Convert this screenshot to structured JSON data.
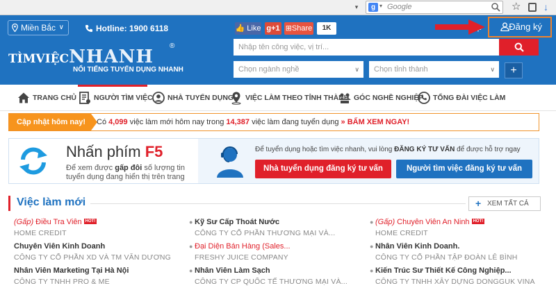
{
  "browser": {
    "search_placeholder": "Google",
    "engine_letter": "g"
  },
  "header": {
    "region": "Miền Bắc",
    "hotline": "Hotline: 1900 6118",
    "social": {
      "like": "Like",
      "gplus": "g+1",
      "share": "Share",
      "count": "1K"
    },
    "login_partial": "ập",
    "register": "Đăng ký",
    "logo_top": "TÌMVIỆC",
    "logo_big": "NHANH",
    "logo_reg": "®",
    "tagline": "NỔI TIẾNG TUYỂN DỤNG NHANH",
    "search_placeholder": "Nhập tên công việc, vị trí...",
    "industry_placeholder": "Chọn ngành nghề",
    "province_placeholder": "Chọn tỉnh thành",
    "plus": "+"
  },
  "nav": {
    "items": [
      {
        "label": "TRANG CHỦ"
      },
      {
        "label": "NGƯỜI TÌM VIỆC"
      },
      {
        "label": "NHÀ TUYỂN DỤNG"
      },
      {
        "label": "VIỆC LÀM THEO TỈNH THÀNH"
      },
      {
        "label": "GÓC NGHỀ NGHIỆP"
      },
      {
        "label": "TỔNG ĐÀI VIỆC LÀM"
      }
    ]
  },
  "ticker": {
    "label": "Cập nhật hôm nay!",
    "p1": "Có ",
    "new_count": "4,099",
    "p2": " việc làm mới hôm nay trong ",
    "total_count": "14,387",
    "p3": " việc làm đang tuyển dụng ",
    "cta": "»  BẤM XEM NGAY!"
  },
  "banner": {
    "title_pre": "Nhấn phím ",
    "title_key": "F5",
    "desc_pre": "Để xem được ",
    "desc_bold": "gấp đôi",
    "desc_post": " số lượng tin tuyển dụng đang hiển thị trên trang",
    "consult_pre": "Để tuyển dụng hoặc tìm việc nhanh, vui lòng ",
    "consult_bold": "ĐĂNG KÝ TƯ VẤN",
    "consult_post": " để được hỗ trợ ngay",
    "employer_btn": "Nhà tuyển dụng đăng ký tư vấn",
    "seeker_btn": "Người tìm việc đăng ký tư vấn"
  },
  "new_jobs": {
    "title": "Việc làm mới",
    "view_all": "XEM TẤT CẢ",
    "urgent_tag": "(Gấp)",
    "hot_tag": "HOT!",
    "jobs": [
      {
        "title": " Điều Tra Viên",
        "company": "HOME CREDIT"
      },
      {
        "title": "Kỹ Sư Cấp Thoát Nước",
        "company": "CÔNG TY CỔ PHẦN THƯƠNG MẠI VÀ..."
      },
      {
        "title": " Chuyên Viên An Ninh",
        "company": "HOME CREDIT"
      },
      {
        "title": "Chuyên Viên Kinh Doanh",
        "company": "CÔNG TY CỔ PHẦN XD VÀ TM VĂN DƯƠNG"
      },
      {
        "title": "Đại Diện Bán Hàng (Sales...",
        "company": "FRESHY JUICE COMPANY"
      },
      {
        "title": "Nhân Viên Kinh Doanh.",
        "company": "CÔNG TY CỔ PHẦN TẬP ĐOÀN LÊ BÌNH"
      },
      {
        "title": "Nhân Viên Marketing Tại Hà Nội",
        "company": "CÔNG TY TNHH PRO & ME"
      },
      {
        "title": "Nhân Viên Làm Sạch",
        "company": "CÔNG TY CP QUỐC TẾ THƯƠNG MẠI VÀ..."
      },
      {
        "title": "Kiến Trúc Sư Thiết Kế Công Nghiệp...",
        "company": "CÔNG TY TNHH XÂY DỰNG DONGGUK VINA"
      }
    ]
  },
  "colors": {
    "brand_blue": "#1f72c0",
    "accent_red": "#e0202a",
    "ticker_orange": "#f7941d",
    "highlight_orange": "#f0842d"
  }
}
